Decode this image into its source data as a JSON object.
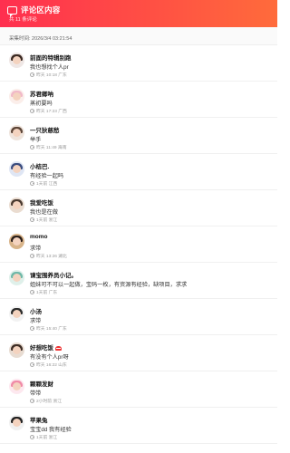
{
  "header": {
    "title": "评论区内容",
    "count": "共 11 条评论"
  },
  "collected_time": "采集时间: 2026/3/4 03:21:54",
  "comments": [
    {
      "name": "前面的特辑别跑",
      "content": "我也想找个人pr",
      "meta": "昨天 10:18 广东",
      "avatar_hair": "#3b2a22",
      "avatar_bg": "#efe7e5"
    },
    {
      "name": "苏君卿呐",
      "content": "蒸初要吗",
      "meta": "昨天 17:23 广西",
      "avatar_hair": "#f1b9c8",
      "avatar_bg": "#fbeeea"
    },
    {
      "name": "一只狄慈愁",
      "content": "举手",
      "meta": "昨天 11:49 海南",
      "avatar_hair": "#5c4537",
      "avatar_bg": "#efe4dc"
    },
    {
      "name": "小桔巴.",
      "content": "有经验一起吗",
      "meta": "1天前 江西",
      "avatar_hair": "#3b4c7e",
      "avatar_bg": "#dfe6f4"
    },
    {
      "name": "我爱吃饭",
      "content": "我也是在做",
      "meta": "1天前 浙江",
      "avatar_hair": "#4a3a30",
      "avatar_bg": "#eadcd0"
    },
    {
      "name": "momo",
      "content": "求带",
      "meta": "昨天 13:26 湖北",
      "avatar_hair": "#2a1f1a",
      "avatar_bg": "#d8b48a"
    },
    {
      "name": "谏宝围养员小记。",
      "content": "姐妹可不可以一起做，宝码一枚，有资源有经验，缺项目，求求",
      "meta": "1天前 广东",
      "avatar_hair": "#6fb8a8",
      "avatar_bg": "#dff0ea"
    },
    {
      "name": "小汤",
      "content": "求带",
      "meta": "昨天 15:40 广东",
      "avatar_hair": "#2b2b2b",
      "avatar_bg": "#f2f2f2"
    },
    {
      "name": "好想吃饭",
      "content": "有没有个人pr呀",
      "meta": "昨天 16:22 山东",
      "avatar_hair": "#3e2e26",
      "avatar_bg": "#e8dcd2"
    },
    {
      "name": "颗颗发财",
      "content": "带带",
      "meta": "2小时前 浙江",
      "avatar_hair": "#f08aa7",
      "avatar_bg": "#fde8ef"
    },
    {
      "name": "苹果兔",
      "content": "宝宝dd 我有经验",
      "meta": "1天前 浙江",
      "avatar_hair": "#222222",
      "avatar_bg": "#f0f0f0"
    }
  ]
}
